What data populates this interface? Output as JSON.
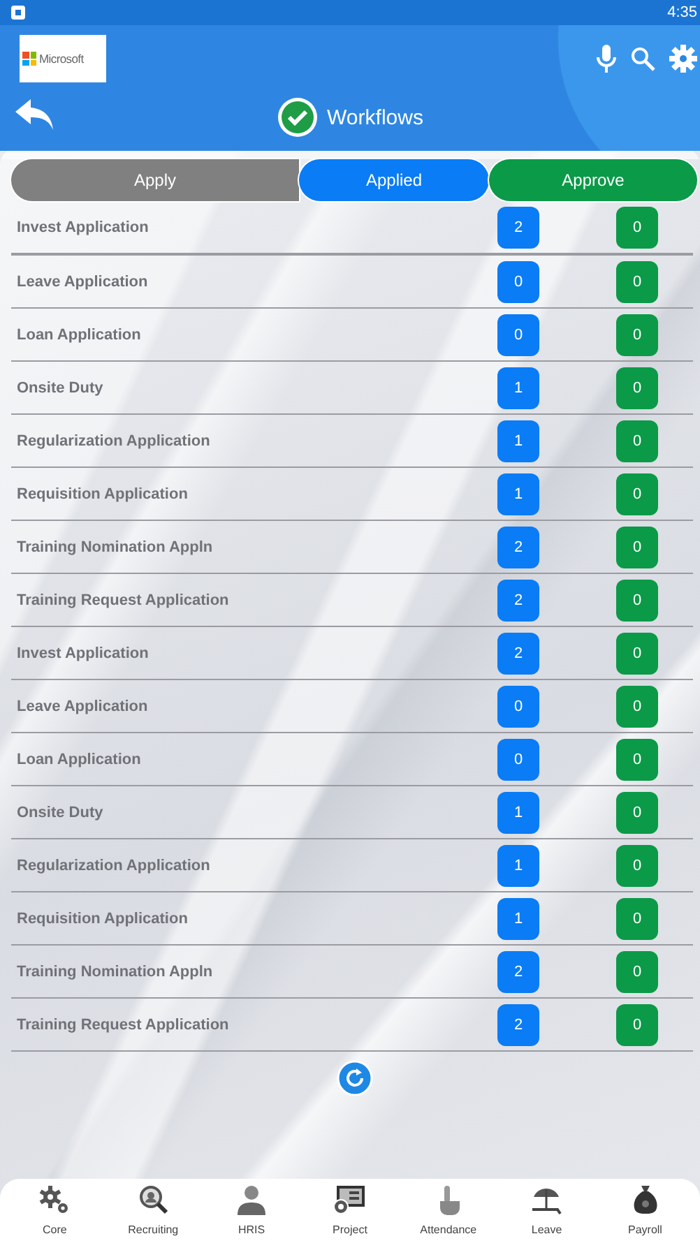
{
  "status_bar": {
    "time": "4:35"
  },
  "header": {
    "logo_text": "Microsoft",
    "title": "Workflows"
  },
  "tabs": [
    {
      "label": "Apply",
      "color": "#808080"
    },
    {
      "label": "Applied",
      "color": "#0a7cf5"
    },
    {
      "label": "Approve",
      "color": "#0b9a48"
    }
  ],
  "rows": [
    {
      "name": "Invest Application",
      "applied": "2",
      "approve": "0"
    },
    {
      "name": "Leave Application",
      "applied": "0",
      "approve": "0"
    },
    {
      "name": "Loan Application",
      "applied": "0",
      "approve": "0"
    },
    {
      "name": "Onsite Duty",
      "applied": "1",
      "approve": "0"
    },
    {
      "name": "Regularization Application",
      "applied": "1",
      "approve": "0"
    },
    {
      "name": "Requisition Application",
      "applied": "1",
      "approve": "0"
    },
    {
      "name": "Training Nomination Appln",
      "applied": "2",
      "approve": "0"
    },
    {
      "name": "Training Request Application",
      "applied": "2",
      "approve": "0"
    },
    {
      "name": "Invest Application",
      "applied": "2",
      "approve": "0"
    },
    {
      "name": "Leave Application",
      "applied": "0",
      "approve": "0"
    },
    {
      "name": "Loan Application",
      "applied": "0",
      "approve": "0"
    },
    {
      "name": "Onsite Duty",
      "applied": "1",
      "approve": "0"
    },
    {
      "name": "Regularization Application",
      "applied": "1",
      "approve": "0"
    },
    {
      "name": "Requisition Application",
      "applied": "1",
      "approve": "0"
    },
    {
      "name": "Training Nomination Appln",
      "applied": "2",
      "approve": "0"
    },
    {
      "name": "Training Request Application",
      "applied": "2",
      "approve": "0"
    }
  ],
  "bottom_nav": [
    {
      "label": "Core",
      "kind": "gears"
    },
    {
      "label": "Recruiting",
      "kind": "magnifier"
    },
    {
      "label": "HRIS",
      "kind": "person"
    },
    {
      "label": "Project",
      "kind": "board"
    },
    {
      "label": "Attendance",
      "kind": "hand"
    },
    {
      "label": "Leave",
      "kind": "beach"
    },
    {
      "label": "Payroll",
      "kind": "moneybag"
    }
  ]
}
